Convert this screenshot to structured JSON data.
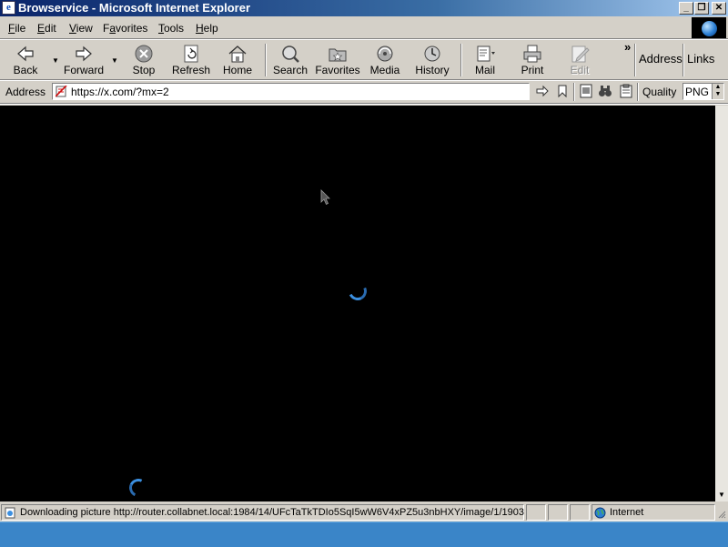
{
  "window": {
    "title": "Browservice - Microsoft Internet Explorer",
    "app_icon": "ie-icon"
  },
  "window_controls": {
    "minimize": "_",
    "maximize": "❐",
    "close": "✕"
  },
  "menu": [
    {
      "label": "File",
      "accel": "F",
      "rest": "ile"
    },
    {
      "label": "Edit",
      "accel": "E",
      "rest": "dit"
    },
    {
      "label": "View",
      "accel": "V",
      "rest": "iew"
    },
    {
      "label": "Favorites",
      "accel": "a",
      "pre": "F",
      "rest": "vorites"
    },
    {
      "label": "Tools",
      "accel": "T",
      "rest": "ools"
    },
    {
      "label": "Help",
      "accel": "H",
      "rest": "elp"
    }
  ],
  "toolbar": {
    "back": "Back",
    "forward": "Forward",
    "stop": "Stop",
    "refresh": "Refresh",
    "home": "Home",
    "search": "Search",
    "favorites": "Favorites",
    "media": "Media",
    "history": "History",
    "mail": "Mail",
    "print": "Print",
    "edit": "Edit",
    "chevron": "»",
    "address": "Address",
    "links": "Links"
  },
  "address_bar": {
    "label": "Address",
    "url": "https://x.com/?mx=2",
    "quality_label": "Quality",
    "quality_value": "PNG"
  },
  "status": {
    "text": "Downloading picture http://router.collabnet.local:1984/14/UFcTaTkTDIo5SqI5wW6V4xPZ5u3nbHXY/image/1/1903/",
    "zone": "Internet"
  },
  "colors": {
    "content_bg": "#000000",
    "spinner": "#3b8fe0",
    "taskbar": "#3a85c8"
  }
}
